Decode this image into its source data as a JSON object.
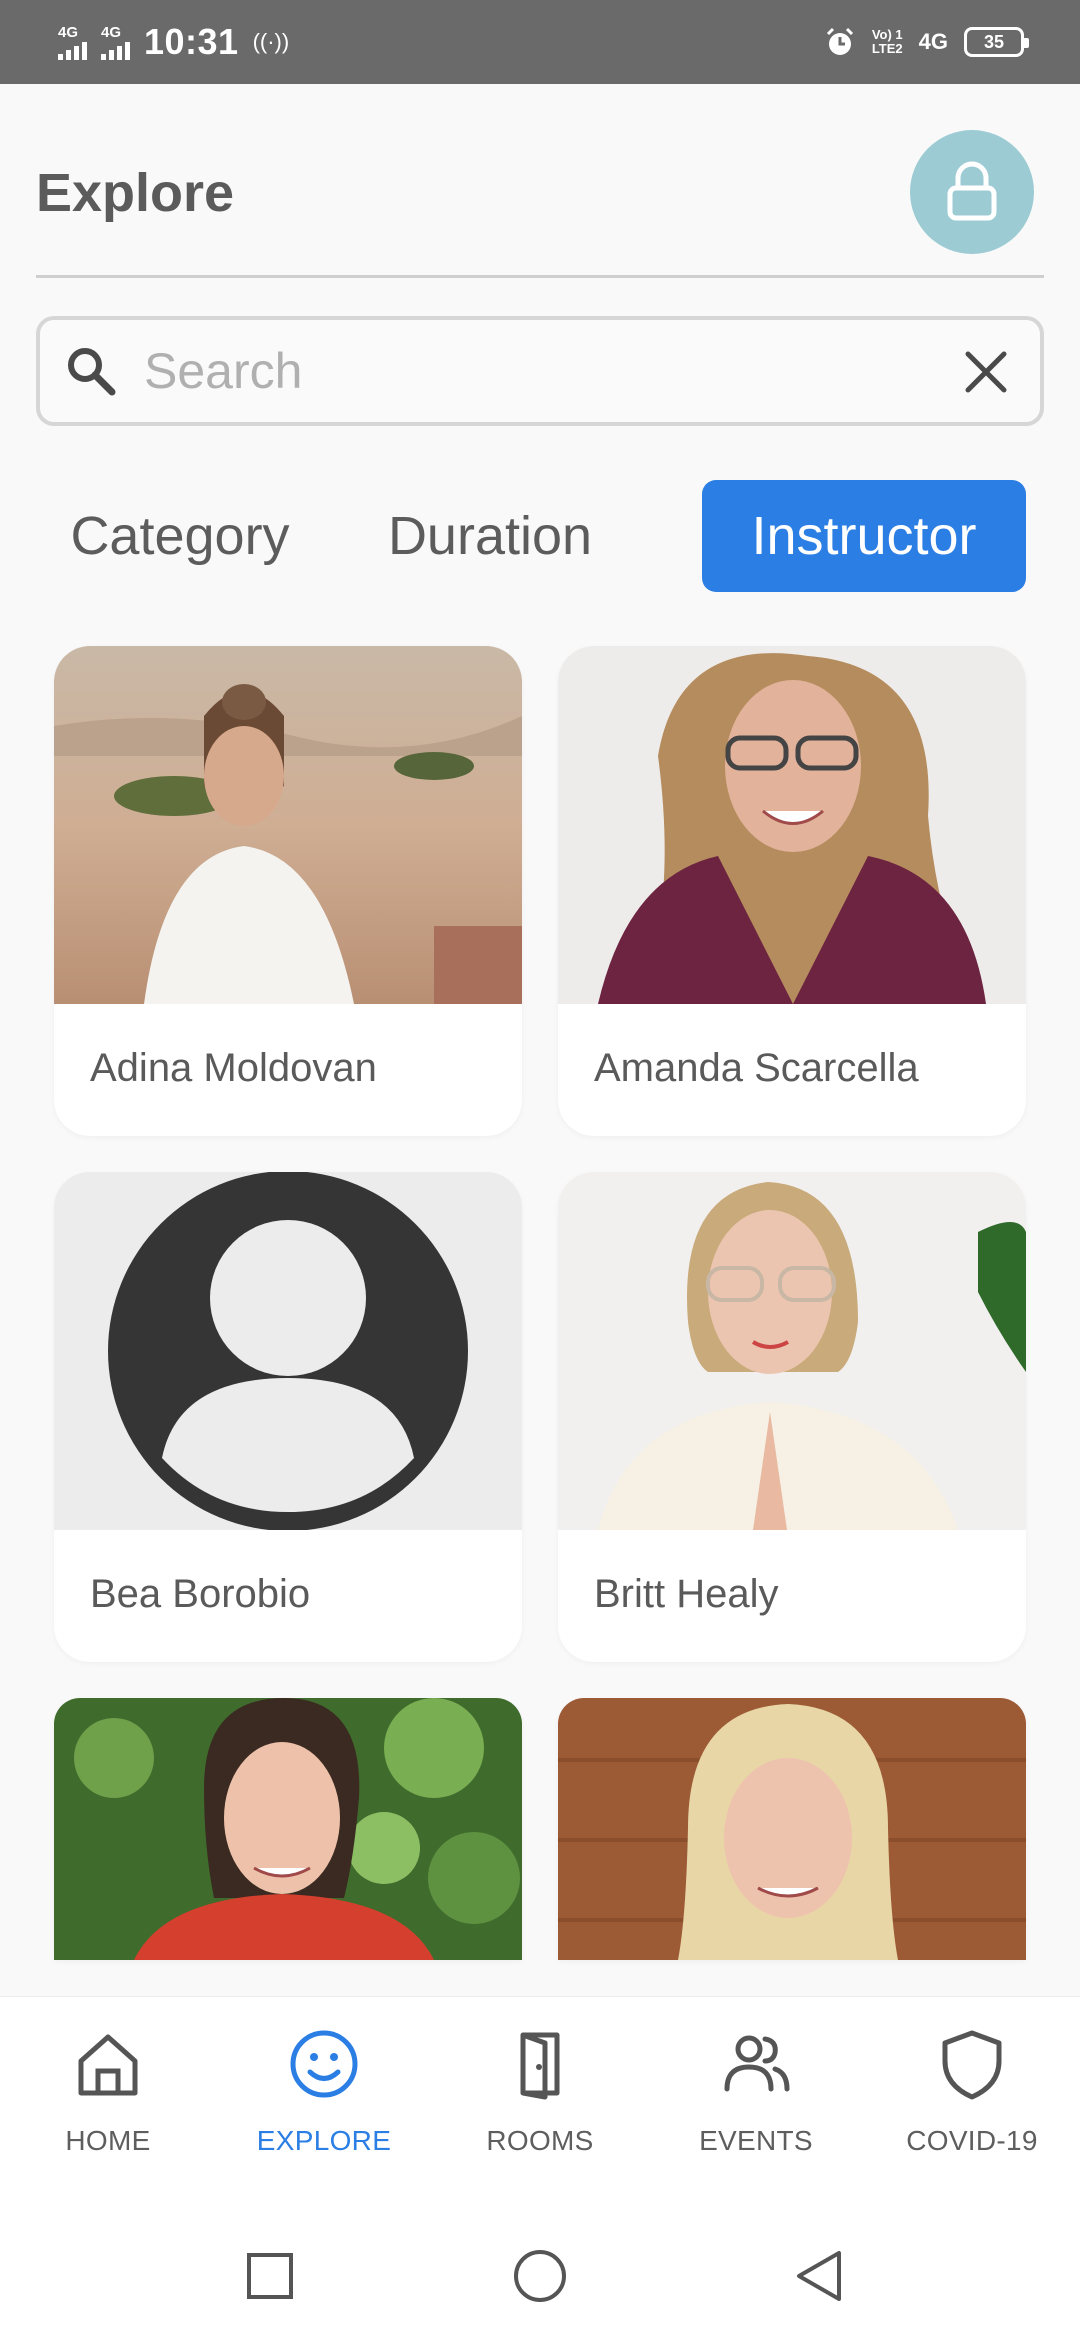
{
  "status_bar": {
    "signal1": "4G",
    "signal2": "4G",
    "time": "10:31",
    "hotspot": "((·))",
    "volte_top": "Vo) 1",
    "volte_bottom": "LTE2",
    "network": "4G",
    "battery": "35"
  },
  "header": {
    "title": "Explore",
    "lock_icon": "lock-icon"
  },
  "search": {
    "placeholder": "Search",
    "value": ""
  },
  "filters": {
    "category": "Category",
    "duration": "Duration",
    "instructor": "Instructor",
    "active": "Instructor"
  },
  "instructors": [
    {
      "name": "Adina Moldovan"
    },
    {
      "name": "Amanda Scarcella"
    },
    {
      "name": "Bea Borobio"
    },
    {
      "name": "Britt Healy"
    }
  ],
  "bottom_nav": {
    "home": "HOME",
    "explore": "EXPLORE",
    "rooms": "ROOMS",
    "events": "EVENTS",
    "covid": "COVID-19",
    "active": "EXPLORE"
  },
  "colors": {
    "accent": "#2b7ee4",
    "lock_bg": "#9ccbd3",
    "status_bar": "#6a6a6a"
  }
}
